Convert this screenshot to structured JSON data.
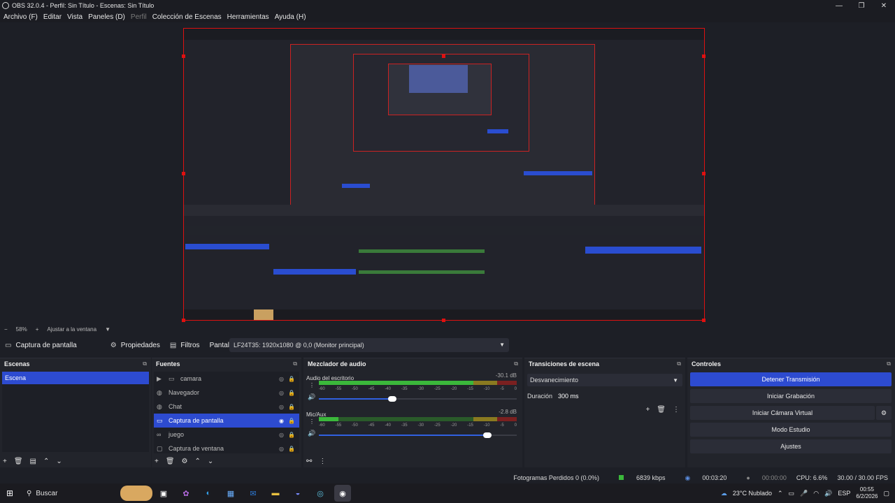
{
  "window": {
    "title": "OBS 32.0.4 - Perfil: Sin Título - Escenas: Sin Título"
  },
  "menu": [
    "Archivo (F)",
    "Editar",
    "Vista",
    "Paneles (D)",
    "Perfil",
    "Colección de Escenas",
    "Herramientas",
    "Ayuda (H)"
  ],
  "zoom": {
    "minus": "−",
    "percent": "58%",
    "plus": "+",
    "fit": "Ajustar a la ventana"
  },
  "source_toolbar": {
    "name": "Captura de pantalla",
    "properties": "Propiedades",
    "filters": "Filtros",
    "display_label": "Pantalla",
    "display_value": "LF24T35: 1920x1080 @ 0,0 (Monitor principal)"
  },
  "scenes": {
    "title": "Escenas",
    "items": [
      "Escena"
    ]
  },
  "sources": {
    "title": "Fuentes",
    "items": [
      {
        "label": "camara",
        "icon": "folder-icon",
        "selected": false
      },
      {
        "label": "Navegador",
        "icon": "globe-icon",
        "selected": false
      },
      {
        "label": "Chat",
        "icon": "globe-icon",
        "selected": false
      },
      {
        "label": "Captura de pantalla",
        "icon": "monitor-icon",
        "selected": true
      },
      {
        "label": "juego",
        "icon": "gamepad-icon",
        "selected": false
      },
      {
        "label": "Captura de ventana",
        "icon": "window-icon",
        "selected": false
      }
    ]
  },
  "mixer": {
    "title": "Mezclador de audio",
    "channels": [
      {
        "name": "Audio del escritorio",
        "db": "-30.1 dB",
        "level": 0.37
      },
      {
        "name": "Mic/Aux",
        "db": "-2.8 dB",
        "level": 0.85
      }
    ],
    "ticks": [
      "-60",
      "-55",
      "-50",
      "-45",
      "-40",
      "-35",
      "-30",
      "-25",
      "-20",
      "-15",
      "-10",
      "-5",
      "0"
    ]
  },
  "transitions": {
    "title": "Transiciones de escena",
    "selected": "Desvanecimiento",
    "duration_label": "Duración",
    "duration_value": "300 ms"
  },
  "controls": {
    "title": "Controles",
    "buttons": [
      "Detener Transmisión",
      "Iniciar Grabación",
      "Iniciar Cámara Virtual",
      "Modo Estudio",
      "Ajustes"
    ]
  },
  "status": {
    "dropped": "Fotogramas Perdidos 0 (0.0%)",
    "bitrate": "6839 kbps",
    "stream_time": "00:03:20",
    "rec_time": "00:00:00",
    "cpu": "CPU: 6.6%",
    "fps": "30.00 / 30.00 FPS"
  },
  "taskbar": {
    "search": "Buscar",
    "weather": "23°C  Nublado",
    "lang": "ESP",
    "time": "00:55",
    "date": "6/2/2026"
  }
}
